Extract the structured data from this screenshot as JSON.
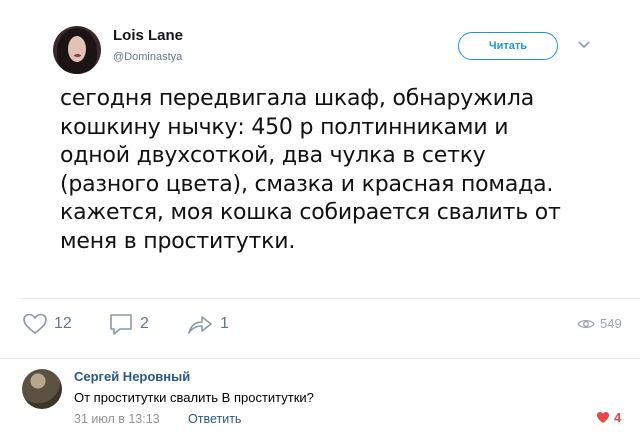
{
  "tweet": {
    "author_name": "Lois Lane",
    "author_handle": "@Dominastya",
    "follow_label": "Читать",
    "text_lines": [
      "сегодня передвигала шкаф, обнаружила",
      "кошкину нычку: 450 р полтинниками и",
      "одной двухсоткой, два чулка в сетку",
      "(разного цвета), смазка и красная помада.",
      "кажется, моя кошка  собирается свалить от",
      "меня в проститутки."
    ],
    "actions": {
      "likes": "12",
      "replies": "2",
      "reposts": "1",
      "views": "549"
    },
    "icons": {
      "like": "heart-outline-icon",
      "reply": "comment-icon",
      "repost": "share-arrow-icon",
      "views": "eye-icon",
      "caret": "chevron-down-icon"
    },
    "accent_color": "#1b95e0"
  },
  "comment": {
    "author_name": "Сергей Неровный",
    "text": "От проститутки свалить В проститутки?",
    "date": "31 июл в 13:13",
    "reply_label": "Ответить",
    "likes": "4",
    "like_color": "#e64646",
    "name_color": "#2a5885"
  }
}
